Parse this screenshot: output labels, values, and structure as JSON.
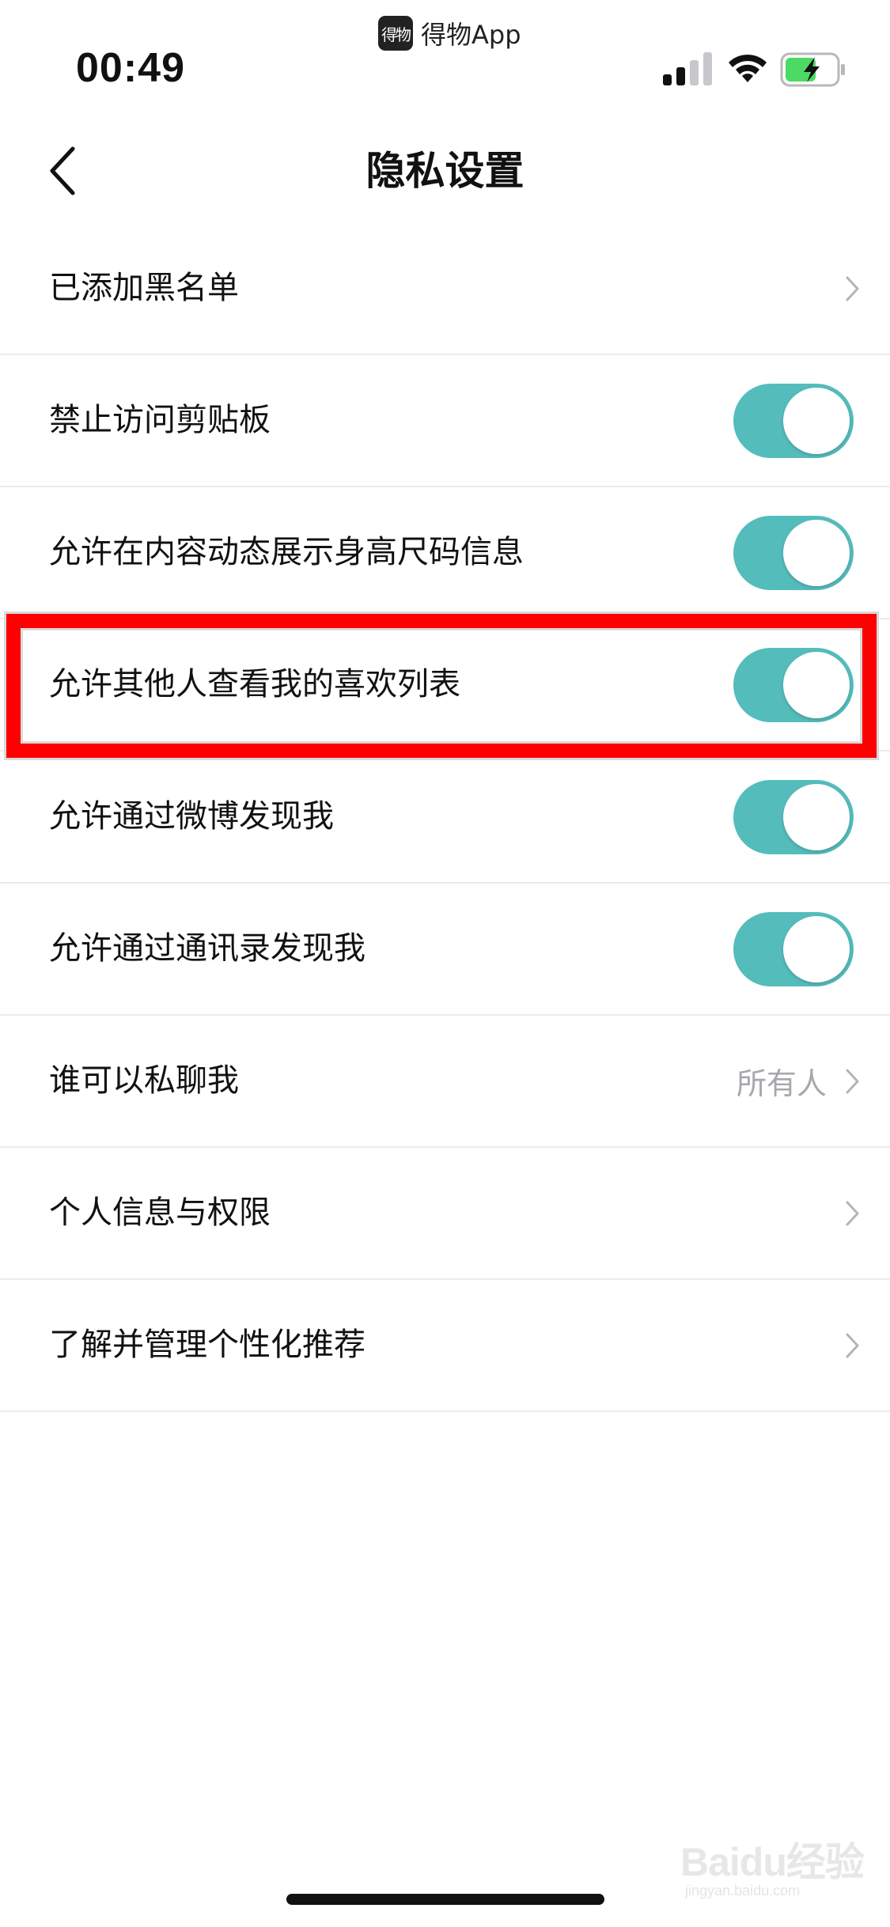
{
  "status_bar": {
    "time": "00:49",
    "source_app_badge": "得物",
    "source_app_name": "得物App",
    "signal_icon": "cellular-signal-icon",
    "wifi_icon": "wifi-icon",
    "battery_icon": "battery-charging-icon",
    "battery_color": "#4cd964"
  },
  "nav": {
    "back_icon": "chevron-left-icon",
    "title": "隐私设置"
  },
  "settings": {
    "items": [
      {
        "label": "已添加黑名单",
        "control": "chevron"
      },
      {
        "label": "禁止访问剪贴板",
        "control": "toggle",
        "on": true
      },
      {
        "label": "允许在内容动态展示身高尺码信息",
        "control": "toggle",
        "on": true
      },
      {
        "label": "允许其他人查看我的喜欢列表",
        "control": "toggle",
        "on": true,
        "highlighted": true
      },
      {
        "label": "允许通过微博发现我",
        "control": "toggle",
        "on": true
      },
      {
        "label": "允许通过通讯录发现我",
        "control": "toggle",
        "on": true
      },
      {
        "label": "谁可以私聊我",
        "control": "chevron",
        "value": "所有人"
      },
      {
        "label": "个人信息与权限",
        "control": "chevron"
      },
      {
        "label": "了解并管理个性化推荐",
        "control": "chevron"
      }
    ]
  },
  "colors": {
    "toggle_on": "#55bcbc",
    "highlight": "#ff0000",
    "secondary_text": "#a7a7ad"
  },
  "watermark": {
    "logo": "Baidu经验",
    "domain": "jingyan.baidu.com"
  }
}
